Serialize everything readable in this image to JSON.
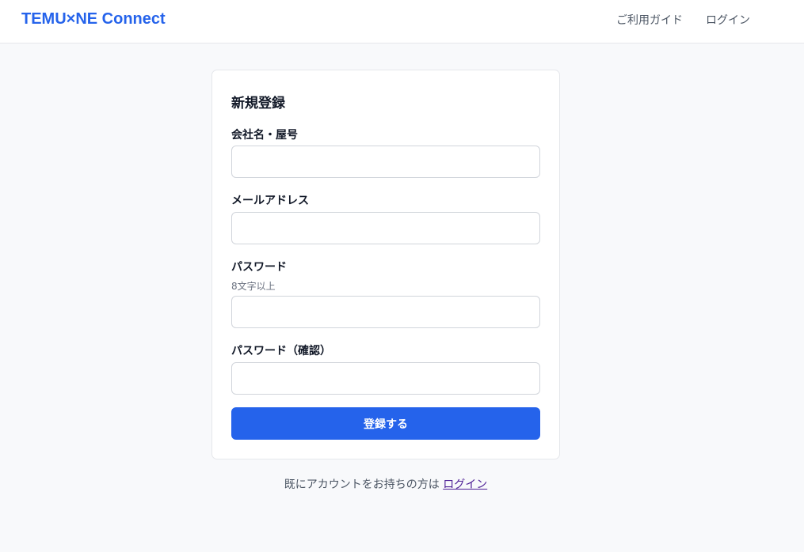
{
  "header": {
    "brand": "TEMU×NE Connect",
    "nav": {
      "guide": "ご利用ガイド",
      "login": "ログイン"
    }
  },
  "form": {
    "title": "新規登録",
    "company": {
      "label": "会社名・屋号",
      "value": ""
    },
    "email": {
      "label": "メールアドレス",
      "value": ""
    },
    "password": {
      "label": "パスワード",
      "hint": "8文字以上",
      "value": ""
    },
    "password_confirm": {
      "label": "パスワード（確認）",
      "value": ""
    },
    "submit_label": "登録する"
  },
  "footer": {
    "prompt": "既にアカウントをお持ちの方は",
    "login_link": "ログイン"
  },
  "colors": {
    "accent": "#2563eb",
    "background": "#f8f9fb",
    "link_visited": "#4c1d95"
  }
}
